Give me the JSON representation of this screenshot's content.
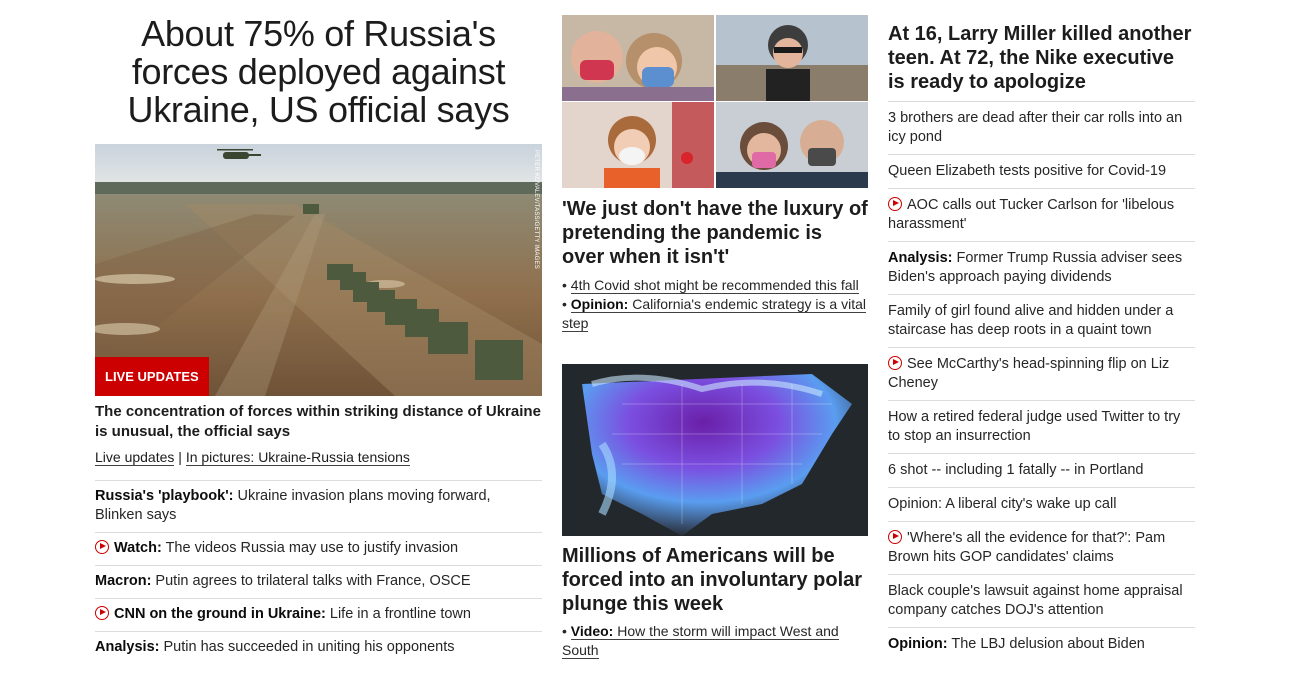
{
  "left": {
    "headline": "About 75% of Russia's forces deployed against Ukraine, US official says",
    "image_alt": "Military convoy of trucks on a dirt field with helicopter overhead",
    "photo_credit": "PETER KOVALEV/TASS/GETTY IMAGES",
    "badge": "LIVE UPDATES",
    "subheadline": "The concentration of forces within striking distance of Ukraine is unusual, the official says",
    "link_live": "Live updates",
    "link_separator": " | ",
    "link_pictures": "In pictures: Ukraine-Russia tensions",
    "items": [
      {
        "bold": "Russia's 'playbook':",
        "text": " Ukraine invasion plans moving forward, Blinken says"
      },
      {
        "video": true,
        "bold": "Watch:",
        "text": " The videos Russia may use to justify invasion"
      },
      {
        "bold": "Macron:",
        "text": " Putin agrees to trilateral talks with France, OSCE"
      },
      {
        "video": true,
        "bold": "CNN on the ground in Ukraine:",
        "text": " Life in a frontline town"
      },
      {
        "bold": "Analysis:",
        "text": " Putin has succeeded in uniting his opponents"
      }
    ]
  },
  "middle": {
    "story1": {
      "headline": "'We just don't have the luxury of pretending the pandemic is over when it isn't'",
      "link1": "4th Covid shot might be recommended this fall",
      "link2_bold": "Opinion:",
      "link2_text": " California's endemic strategy is a vital step"
    },
    "story2": {
      "headline": "Millions of Americans will be forced into an involuntary polar plunge this week",
      "link_bold": "Video:",
      "link_text": " How the storm will impact West and South"
    },
    "bullet": "•"
  },
  "right": {
    "headline": "At 16, Larry Miller killed another teen. At 72, the Nike executive is ready to apologize",
    "items": [
      {
        "text": "3 brothers are dead after their car rolls into an icy pond"
      },
      {
        "text": "Queen Elizabeth tests positive for Covid-19"
      },
      {
        "video": true,
        "text": "AOC calls out Tucker Carlson for 'libelous harassment'"
      },
      {
        "bold": "Analysis:",
        "text": " Former Trump Russia adviser sees Biden's approach paying dividends"
      },
      {
        "text": "Family of girl found alive and hidden under a staircase has deep roots in a quaint town"
      },
      {
        "video": true,
        "text": "See McCarthy's head-spinning flip on Liz Cheney"
      },
      {
        "text": "How a retired federal judge used Twitter to try to stop an insurrection"
      },
      {
        "text": "6 shot -- including 1 fatally -- in Portland"
      },
      {
        "text": "Opinion: A liberal city's wake up call"
      },
      {
        "video": true,
        "text": "'Where's all the evidence for that?': Pam Brown hits GOP candidates' claims"
      },
      {
        "text": "Black couple's lawsuit against home appraisal company catches DOJ's attention"
      },
      {
        "bold": "Opinion:",
        "text": " The LBJ delusion about Biden"
      }
    ]
  },
  "colors": {
    "accent_red": "#cc0000",
    "text": "#0c0c0c",
    "divider": "#dcdcdc"
  }
}
